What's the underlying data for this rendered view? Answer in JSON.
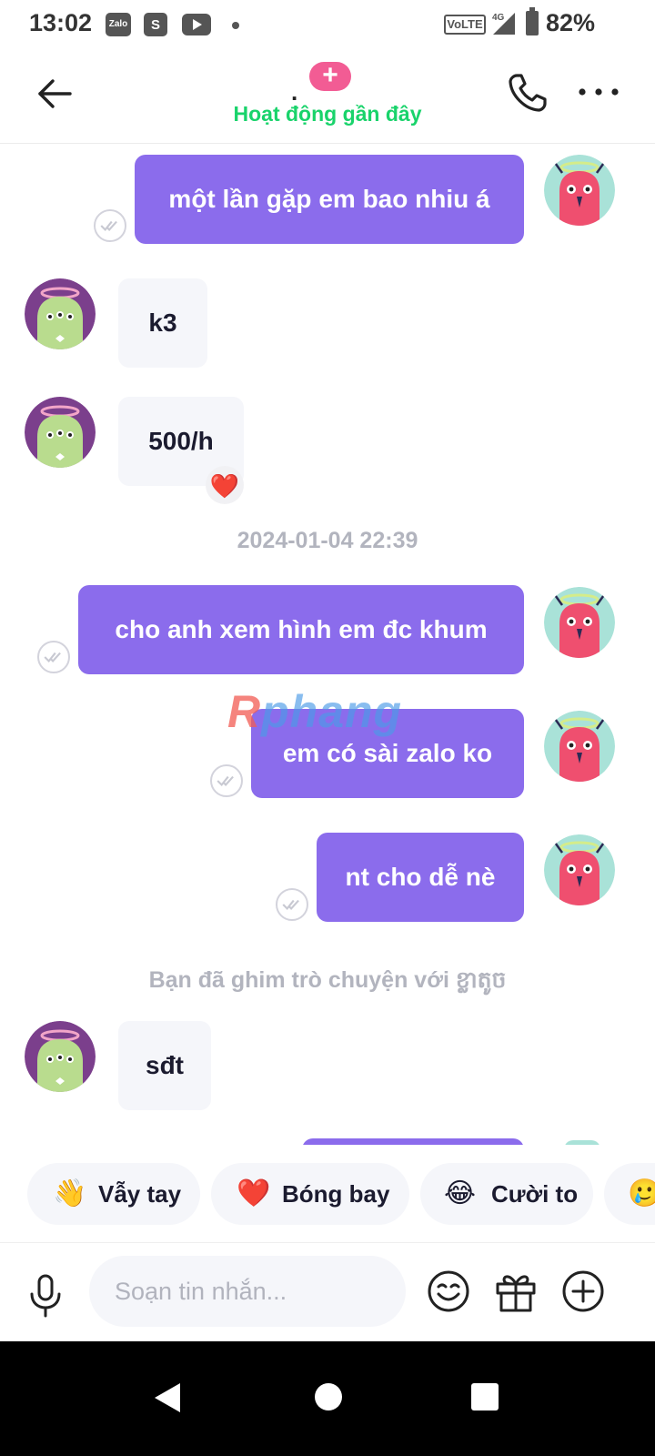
{
  "status_bar": {
    "time": "13:02",
    "zalo_label": "Zalo",
    "shop_label": "S",
    "volte": "VoLTE",
    "network": "4G",
    "battery": "82%"
  },
  "header": {
    "title": ".",
    "add_symbol": "+",
    "status": "Hoạt động gần đây"
  },
  "messages": [
    {
      "side": "out",
      "text": "một lần gặp em bao nhiu á"
    },
    {
      "side": "in",
      "text": "k3"
    },
    {
      "side": "in",
      "text": "500/h",
      "reaction": "❤️"
    },
    {
      "side": "system",
      "text": "2024-01-04 22:39"
    },
    {
      "side": "out",
      "text": "cho anh xem hình em đc khum"
    },
    {
      "side": "out",
      "text": "em có sài zalo ko"
    },
    {
      "side": "out",
      "text": "nt cho dễ nè"
    },
    {
      "side": "system",
      "text": "Bạn đã ghim trò chuyện với ខ្លាតូច"
    },
    {
      "side": "in",
      "text": "sđt"
    }
  ],
  "watermark": {
    "first": "R",
    "rest": "phang"
  },
  "quick_reactions": [
    {
      "emoji": "👋",
      "label": "Vẫy tay"
    },
    {
      "emoji": "❤️",
      "label": "Bóng bay"
    },
    {
      "emoji": "😂",
      "label": "Cười to"
    },
    {
      "emoji": "🥲",
      "label": ""
    }
  ],
  "composer": {
    "placeholder": "Soạn tin nhắn..."
  },
  "icons": {
    "back": "arrow-left-icon",
    "call": "phone-icon",
    "more": "more-dots-icon",
    "mic": "microphone-icon",
    "emoji": "emoji-icon",
    "gift": "gift-icon",
    "plus": "plus-circle-icon"
  },
  "colors": {
    "outgoing_bubble": "#8b6cec",
    "incoming_bubble": "#f5f6fa",
    "online_status": "#19d36b",
    "add_pill": "#f25c94",
    "system_text": "#b2b4be"
  }
}
